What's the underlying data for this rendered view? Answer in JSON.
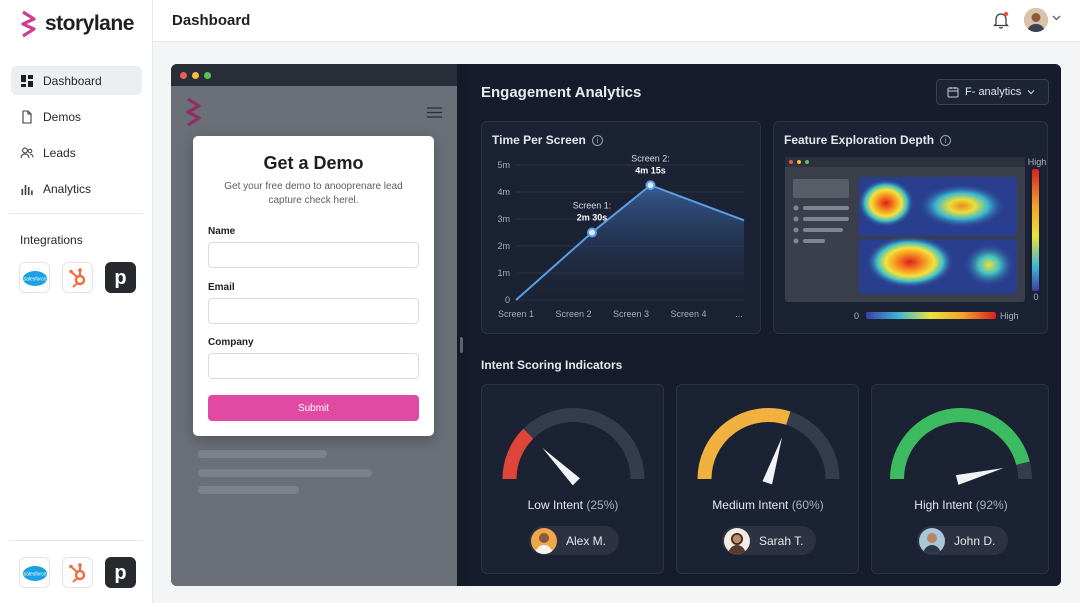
{
  "app": {
    "brand": "storylane"
  },
  "header": {
    "title": "Dashboard"
  },
  "sidebar": {
    "items": [
      {
        "label": "Dashboard",
        "icon": "dashboard-icon"
      },
      {
        "label": "Demos",
        "icon": "document-icon"
      },
      {
        "label": "Leads",
        "icon": "users-icon"
      },
      {
        "label": "Analytics",
        "icon": "bar-chart-icon"
      }
    ],
    "integrations_label": "Integrations",
    "integrations": [
      {
        "name": "Salesforce",
        "icon": "salesforce-icon",
        "text": "salesforce"
      },
      {
        "name": "HubSpot",
        "icon": "hubspot-icon"
      },
      {
        "name": "Pipedrive",
        "icon": "pipedrive-icon",
        "text": "p"
      }
    ]
  },
  "demo_form": {
    "title": "Get a Demo",
    "subtitle": "Get your free demo to anooprenare lead capture check herel.",
    "fields": [
      {
        "label": "Name",
        "value": ""
      },
      {
        "label": "Email",
        "value": ""
      },
      {
        "label": "Company",
        "value": ""
      }
    ],
    "submit_label": "Submit"
  },
  "analytics": {
    "title": "Engagement Analytics",
    "filter_label": "F- analytics",
    "time_per_screen": {
      "title": "Time Per Screen"
    },
    "feature_depth": {
      "title": "Feature Exploration Depth",
      "legend_high": "High",
      "legend_low": "0",
      "scale_min": "0",
      "scale_max": "High"
    },
    "intent_title": "Intent Scoring Indicators",
    "intent": [
      {
        "label": "Low Intent",
        "percent": "(25%)",
        "value": 25,
        "color": "#e0453a",
        "person": "Alex M."
      },
      {
        "label": "Medium Intent",
        "percent": "(60%)",
        "value": 60,
        "color": "#f1b13e",
        "person": "Sarah T."
      },
      {
        "label": "High Intent",
        "percent": "(92%)",
        "value": 92,
        "color": "#3dbb61",
        "person": "John D."
      }
    ]
  },
  "chart_data": {
    "type": "area",
    "title": "Time Per Screen",
    "categories": [
      "Screen 1",
      "Screen 2",
      "Screen 3",
      "Screen 4",
      "..."
    ],
    "x": [
      0,
      1.3,
      2.3,
      3.9
    ],
    "values": [
      0,
      2.5,
      4.25,
      2.95
    ],
    "y_ticks": [
      "0",
      "1m",
      "2m",
      "3m",
      "4m",
      "5m"
    ],
    "ylim": [
      0,
      5
    ],
    "annotations": [
      {
        "label": "Screen 1:",
        "value": "2m 30s",
        "index": 1
      },
      {
        "label": "Screen 2:",
        "value": "4m 15s",
        "index": 2
      }
    ],
    "color": "#5a9fe6"
  }
}
